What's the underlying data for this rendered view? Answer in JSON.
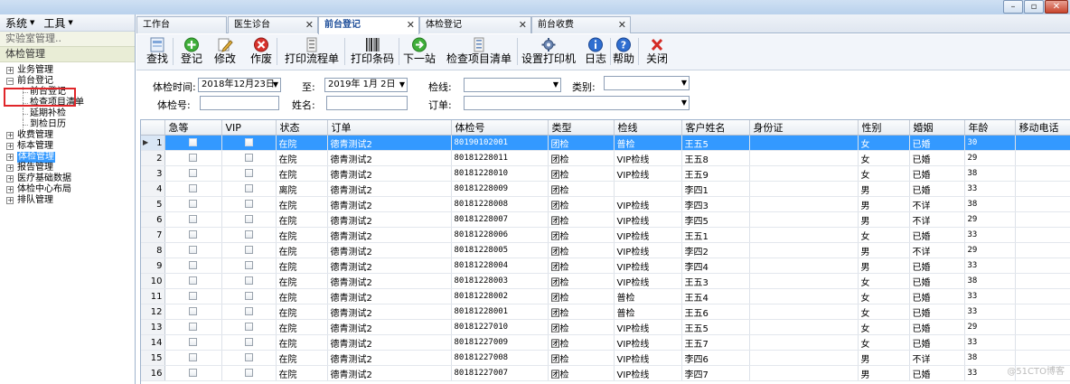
{
  "menu": {
    "system": "系统",
    "tools": "工具"
  },
  "left_sections": {
    "lab": "实验室管理..",
    "exam": "体检管理"
  },
  "tree": [
    {
      "label": "业务管理",
      "expanded": false,
      "children": []
    },
    {
      "label": "前台登记",
      "expanded": true,
      "children": [
        "前台登记",
        "检查项目清单",
        "延期补检",
        "到检日历"
      ]
    },
    {
      "label": "收费管理",
      "expanded": false,
      "children": []
    },
    {
      "label": "标本管理",
      "expanded": false,
      "children": []
    },
    {
      "label": "体检管理",
      "expanded": false,
      "selected": true,
      "children": []
    },
    {
      "label": "报告管理",
      "expanded": false,
      "children": []
    },
    {
      "label": "医疗基础数据",
      "expanded": false,
      "children": []
    },
    {
      "label": "体检中心布局",
      "expanded": false,
      "children": []
    },
    {
      "label": "排队管理",
      "expanded": false,
      "children": []
    }
  ],
  "tabs": [
    "工作台",
    "医生诊台",
    "前台登记",
    "体检登记",
    "前台收费"
  ],
  "active_tab": 2,
  "toolbar": [
    {
      "label": "查找",
      "icon": "search-icon"
    },
    {
      "label": "登记",
      "icon": "add-icon"
    },
    {
      "label": "修改",
      "icon": "edit-icon"
    },
    {
      "label": "作废",
      "icon": "void-icon"
    },
    {
      "label": "打印流程单",
      "icon": "print-doc-icon"
    },
    {
      "label": "打印条码",
      "icon": "barcode-icon"
    },
    {
      "label": "下一站",
      "icon": "next-icon"
    },
    {
      "label": "检查项目清单",
      "icon": "list-icon"
    },
    {
      "label": "设置打印机",
      "icon": "printer-settings-icon"
    },
    {
      "label": "日志",
      "icon": "log-icon"
    },
    {
      "label": "帮助",
      "icon": "help-icon"
    },
    {
      "label": "关闭",
      "icon": "close-icon"
    }
  ],
  "filters": {
    "exam_time_label": "体检时间:",
    "date_from": "2018年12月23日",
    "to_label": "至:",
    "date_to": "2019年 1月 2日",
    "line_label": "检线:",
    "category_label": "类别:",
    "exam_no_label": "体检号:",
    "name_label": "姓名:",
    "order_label": "订单:"
  },
  "grid": {
    "columns": [
      "急等",
      "VIP",
      "状态",
      "订单",
      "体检号",
      "类型",
      "检线",
      "客户姓名",
      "身份证",
      "性别",
      "婚姻",
      "年龄",
      "移动电话"
    ],
    "rows": [
      [
        "1",
        "在院",
        "德青测试2",
        "80190102001",
        "团检",
        "普检",
        "王五5",
        "女",
        "已婚",
        "30"
      ],
      [
        "2",
        "在院",
        "德青测试2",
        "80181228011",
        "团检",
        "VIP检线",
        "王五8",
        "女",
        "已婚",
        "29"
      ],
      [
        "3",
        "在院",
        "德青测试2",
        "80181228010",
        "团检",
        "VIP检线",
        "王五9",
        "女",
        "已婚",
        "38"
      ],
      [
        "4",
        "离院",
        "德青测试2",
        "80181228009",
        "团检",
        "",
        "李四1",
        "男",
        "已婚",
        "33"
      ],
      [
        "5",
        "在院",
        "德青测试2",
        "80181228008",
        "团检",
        "VIP检线",
        "李四3",
        "男",
        "不详",
        "38"
      ],
      [
        "6",
        "在院",
        "德青测试2",
        "80181228007",
        "团检",
        "VIP检线",
        "李四5",
        "男",
        "不详",
        "29"
      ],
      [
        "7",
        "在院",
        "德青测试2",
        "80181228006",
        "团检",
        "VIP检线",
        "王五1",
        "女",
        "已婚",
        "33"
      ],
      [
        "8",
        "在院",
        "德青测试2",
        "80181228005",
        "团检",
        "VIP检线",
        "李四2",
        "男",
        "不详",
        "29"
      ],
      [
        "9",
        "在院",
        "德青测试2",
        "80181228004",
        "团检",
        "VIP检线",
        "李四4",
        "男",
        "已婚",
        "33"
      ],
      [
        "10",
        "在院",
        "德青测试2",
        "80181228003",
        "团检",
        "VIP检线",
        "王五3",
        "女",
        "已婚",
        "38"
      ],
      [
        "11",
        "在院",
        "德青测试2",
        "80181228002",
        "团检",
        "普检",
        "王五4",
        "女",
        "已婚",
        "33"
      ],
      [
        "12",
        "在院",
        "德青测试2",
        "80181228001",
        "团检",
        "普检",
        "王五6",
        "女",
        "已婚",
        "33"
      ],
      [
        "13",
        "在院",
        "德青测试2",
        "80181227010",
        "团检",
        "VIP检线",
        "王五5",
        "女",
        "已婚",
        "29"
      ],
      [
        "14",
        "在院",
        "德青测试2",
        "80181227009",
        "团检",
        "VIP检线",
        "王五7",
        "女",
        "已婚",
        "33"
      ],
      [
        "15",
        "在院",
        "德青测试2",
        "80181227008",
        "团检",
        "VIP检线",
        "李四6",
        "男",
        "不详",
        "38"
      ],
      [
        "16",
        "在院",
        "德青测试2",
        "80181227007",
        "团检",
        "VIP检线",
        "李四7",
        "男",
        "已婚",
        "33"
      ]
    ],
    "selected_row": 0
  },
  "watermark": "@51CTO博客",
  "colors": {
    "selection": "#3399ff",
    "highlight_box": "#e0262a"
  }
}
